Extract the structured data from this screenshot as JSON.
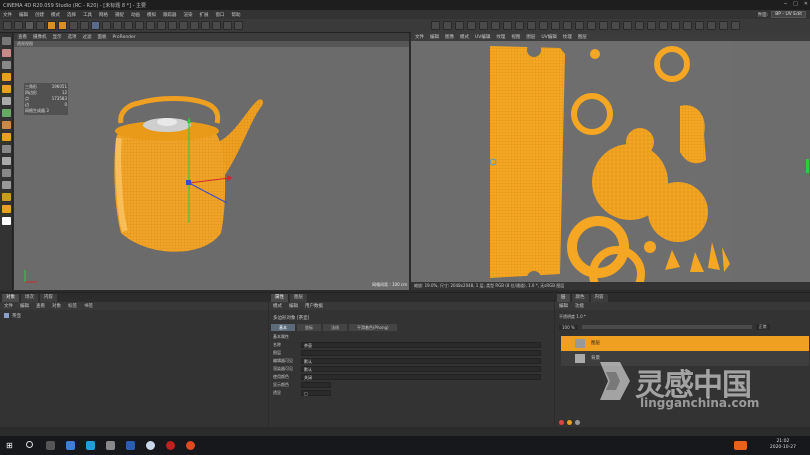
{
  "window": {
    "title": "CINEMA 4D R20.059 Studio (RC - R20) - [未标题 8 *] - 主要"
  },
  "menubar": {
    "items": [
      "文件",
      "编辑",
      "创建",
      "模式",
      "选择",
      "工具",
      "网格",
      "捕捉",
      "动画",
      "模拟",
      "跟踪器",
      "渲染",
      "扩展",
      "窗口",
      "帮助"
    ],
    "layout_selector": "BP - UV Edit"
  },
  "viewport": {
    "menu": [
      "查看",
      "摄像机",
      "显示",
      "选项",
      "过滤",
      "面板",
      "ProRender"
    ],
    "sub_label": "透视视图",
    "stats": [
      {
        "label": "三角形",
        "value": "196051"
      },
      {
        "label": "四边形",
        "value": "12"
      },
      {
        "label": "点",
        "value": "173583"
      },
      {
        "label": "边",
        "value": "0"
      },
      {
        "label": "",
        "value": ""
      }
    ],
    "stats_footer": "网格生成器 3",
    "grid_spacing": "网格间距 : 100 cm",
    "object_color": "#f0a020"
  },
  "uv_editor": {
    "menu": [
      "文件",
      "编辑",
      "图像",
      "模式",
      "UV编辑",
      "纹理",
      "视图",
      "图层",
      "UV编辑",
      "纹理",
      "图层"
    ],
    "status": "缩放: 19.0%, 尺寸: 2048x2048, 1 层, 类型 RGB (8 位/通道), 1.0 *, 无sRGB 图层",
    "uv_color": "#f5a623"
  },
  "objects_panel": {
    "tabs": [
      "对象",
      "场次",
      "内容"
    ],
    "menu": [
      "文件",
      "编辑",
      "查看",
      "对象",
      "标签",
      "书签"
    ]
  },
  "attributes_panel": {
    "tabs": [
      "属性",
      "图层"
    ],
    "menu": [
      "模式",
      "编辑",
      "用户数据"
    ],
    "object_name": "多边形对象 [茶壶]",
    "attr_tabs": [
      "基本",
      "坐标",
      "法线",
      "平滑着色(Phong)"
    ],
    "section_title": "基本属性",
    "fields": [
      {
        "label": "名称",
        "value": "茶壶"
      },
      {
        "label": "图层",
        "value": ""
      },
      {
        "label": "编辑器可见",
        "value": "默认"
      },
      {
        "label": "渲染器可见",
        "value": "默认"
      },
      {
        "label": "使用颜色",
        "value": "关闭"
      },
      {
        "label": "显示颜色",
        "value": ""
      },
      {
        "label": "透显",
        "value": "□"
      }
    ]
  },
  "layers_panel": {
    "tabs": [
      "层",
      "颜色",
      "内容"
    ],
    "menu": [
      "编辑",
      "功能"
    ],
    "blend_mode": "正常",
    "opacity": "100 %",
    "layers": [
      {
        "name": "图层",
        "active": true
      },
      {
        "name": "背景",
        "active": false
      }
    ],
    "layer_label": "不透明度 1.0 *"
  },
  "watermark": {
    "text": "灵感中国",
    "url": "lingganchina.com"
  },
  "taskbar": {
    "time": "21:02",
    "date": "2020-10-27"
  }
}
